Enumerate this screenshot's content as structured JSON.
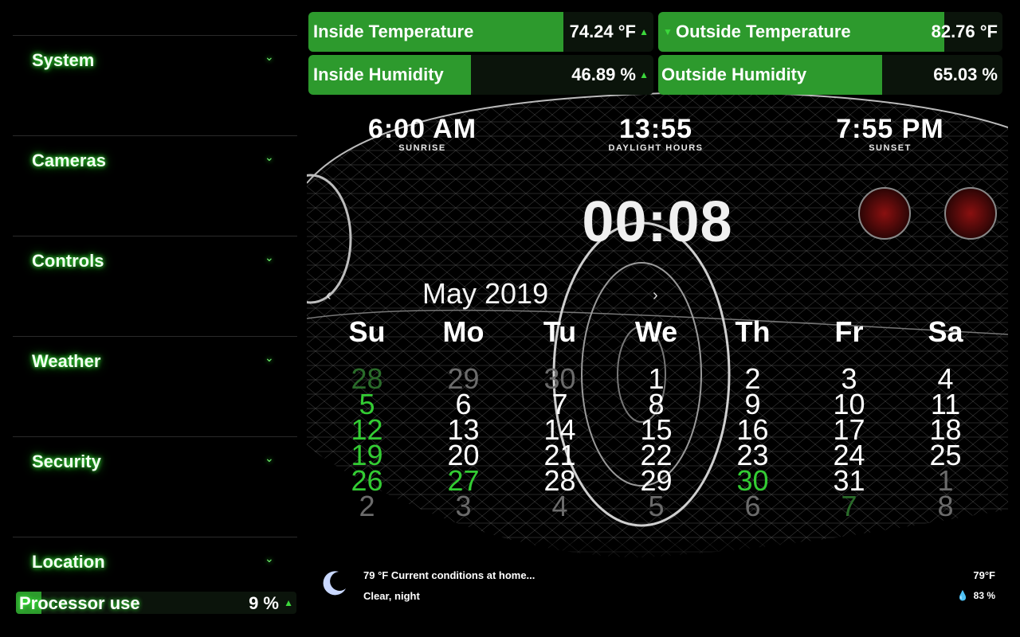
{
  "sidebar": {
    "items": [
      {
        "label": "System"
      },
      {
        "label": "Cameras"
      },
      {
        "label": "Controls"
      },
      {
        "label": "Weather"
      },
      {
        "label": "Security"
      },
      {
        "label": "Location"
      }
    ],
    "processor": {
      "label": "Processor use",
      "value": "9 %",
      "percent": 9
    }
  },
  "sensors": {
    "inside_temp": {
      "label": "Inside Temperature",
      "value": "74.24 °F",
      "percent": 74
    },
    "outside_temp": {
      "label": "Outside Temperature",
      "value": "82.76 °F",
      "percent": 83
    },
    "inside_humidity": {
      "label": "Inside Humidity",
      "value": "46.89 %",
      "percent": 47
    },
    "outside_humidity": {
      "label": "Outside Humidity",
      "value": "65.03 %",
      "percent": 65
    }
  },
  "sun": {
    "sunrise": {
      "time": "6:00 AM",
      "caption": "SUNRISE"
    },
    "daylight": {
      "time": "13:55",
      "caption": "DAYLIGHT HOURS"
    },
    "sunset": {
      "time": "7:55 PM",
      "caption": "SUNSET"
    }
  },
  "clock": "00:08",
  "calendar": {
    "title": "May 2019",
    "weekdays": [
      "Su",
      "Mo",
      "Tu",
      "We",
      "Th",
      "Fr",
      "Sa"
    ],
    "weeks": [
      [
        "28",
        "29",
        "30",
        "1",
        "2",
        "3",
        "4"
      ],
      [
        "5",
        "6",
        "7",
        "8",
        "9",
        "10",
        "11"
      ],
      [
        "12",
        "13",
        "14",
        "15",
        "16",
        "17",
        "18"
      ],
      [
        "19",
        "20",
        "21",
        "22",
        "23",
        "24",
        "25"
      ],
      [
        "26",
        "27",
        "28",
        "29",
        "30",
        "31",
        "1"
      ],
      [
        "2",
        "3",
        "4",
        "5",
        "6",
        "7",
        "8"
      ]
    ]
  },
  "weather": {
    "line1": "79 °F Current conditions at home...",
    "line2": "Clear, night",
    "temp": "79°F",
    "humidity": "83 %"
  },
  "colors": {
    "accent_green": "#2d9a2d",
    "glow": "#3cff3c",
    "highlight_day": "#33cc33"
  }
}
